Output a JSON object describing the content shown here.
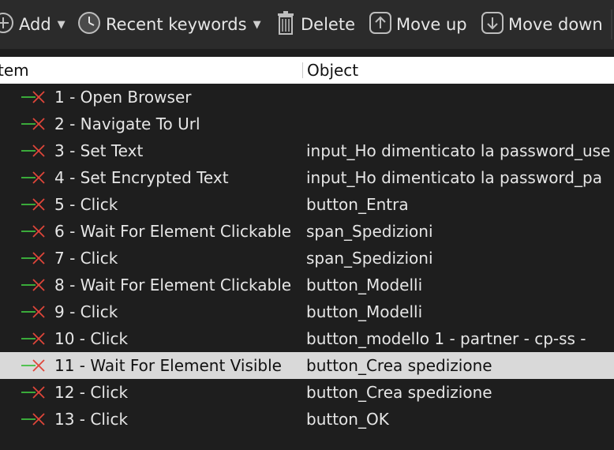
{
  "toolbar": {
    "add_label": "Add",
    "recent_label": "Recent keywords",
    "delete_label": "Delete",
    "move_up_label": "Move up",
    "move_down_label": "Move down",
    "icons": {
      "add": "add-icon",
      "recent": "clock-icon",
      "delete": "trash-icon",
      "move_up": "arrow-up-icon",
      "move_down": "arrow-down-icon"
    }
  },
  "table": {
    "columns": [
      "tem",
      "Object"
    ],
    "rows": [
      {
        "item": "1 - Open Browser",
        "object": ""
      },
      {
        "item": "2 - Navigate To Url",
        "object": ""
      },
      {
        "item": "3 - Set Text",
        "object": "input_Ho dimenticato la password_use"
      },
      {
        "item": "4 - Set Encrypted Text",
        "object": "input_Ho dimenticato la password_pa"
      },
      {
        "item": "5 - Click",
        "object": "button_Entra"
      },
      {
        "item": "6 - Wait For Element Clickable",
        "object": "span_Spedizioni"
      },
      {
        "item": "7 - Click",
        "object": "span_Spedizioni"
      },
      {
        "item": "8 - Wait For Element Clickable",
        "object": "button_Modelli"
      },
      {
        "item": "9 - Click",
        "object": "button_Modelli"
      },
      {
        "item": "10 - Click",
        "object": "button_modello 1 - partner - cp-ss -"
      },
      {
        "item": "11 - Wait For Element Visible",
        "object": "button_Crea spedizione",
        "selected": true
      },
      {
        "item": "12 - Click",
        "object": "button_Crea spedizione"
      },
      {
        "item": "13 - Click",
        "object": "button_OK"
      }
    ]
  },
  "colors": {
    "background": "#1e1e1e",
    "toolbar": "#2b2b2b",
    "selected_row": "#d9d9d9",
    "step_icon_green": "#3fbf3f",
    "step_icon_red": "#e0463a"
  }
}
